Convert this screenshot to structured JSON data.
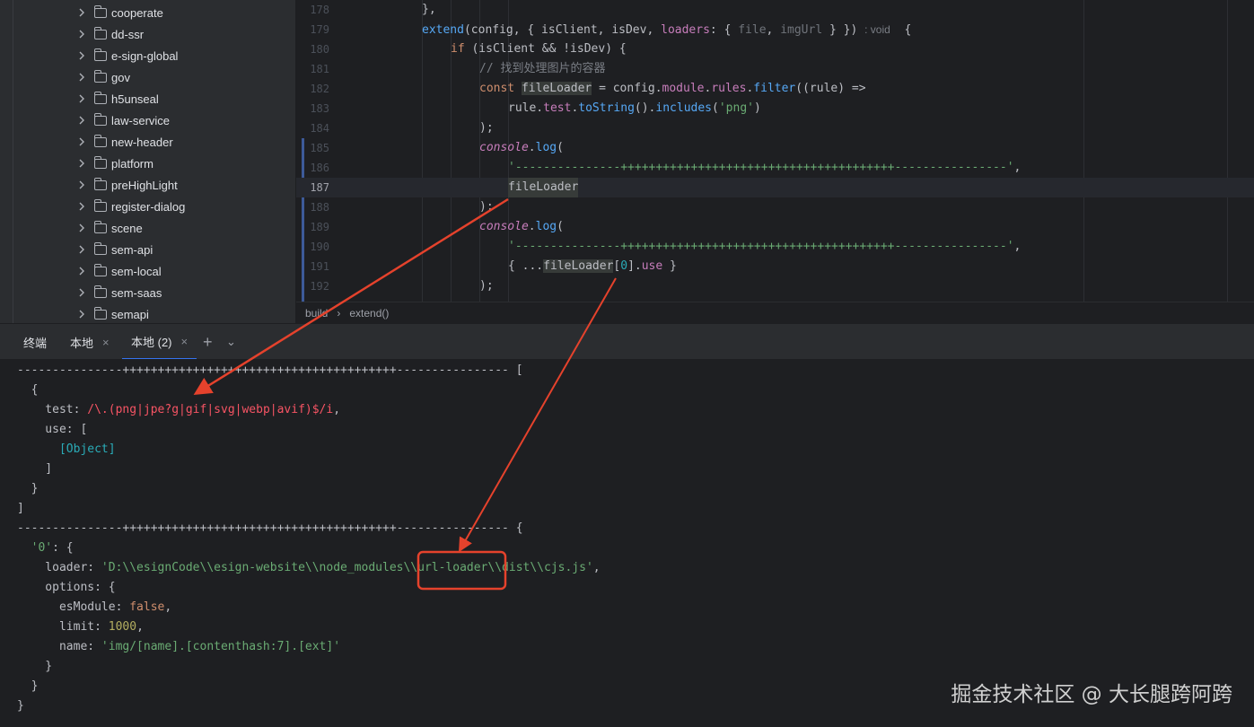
{
  "colors": {
    "background": "#1e1f22",
    "panel": "#2b2d30",
    "keyword": "#cf8e6d",
    "function": "#56a8f5",
    "string": "#6aab73",
    "property": "#c77dbb",
    "number": "#2aacb8",
    "red": "#f75464",
    "arrow": "#e5422c"
  },
  "project_tree": {
    "items": [
      "cooperate",
      "dd-ssr",
      "e-sign-global",
      "gov",
      "h5unseal",
      "law-service",
      "new-header",
      "platform",
      "preHighLight",
      "register-dialog",
      "scene",
      "sem-api",
      "sem-local",
      "sem-saas",
      "semapi"
    ]
  },
  "editor": {
    "line_numbers": [
      "178",
      "179",
      "180",
      "181",
      "182",
      "183",
      "184",
      "185",
      "186",
      "187",
      "188",
      "189",
      "190",
      "191",
      "192"
    ],
    "l178": "},",
    "l179": {
      "a": "extend",
      "b": "(config, { isClient, isDev, ",
      "c": "loaders",
      "d": ": { ",
      "e": "file",
      "f": ", ",
      "g": "imgUrl",
      "h": " } }) ",
      "hint": ": void",
      "i": "  {"
    },
    "l180": {
      "a": "if",
      "b": " (isClient && !isDev) {"
    },
    "l181": "// 找到处理图片的容器",
    "l182": {
      "a": "const ",
      "b": "fileLoader",
      "c": " = config.",
      "d": "module",
      "e": ".",
      "f": "rules",
      "g": ".",
      "h": "filter",
      "i": "((rule) =>"
    },
    "l183": {
      "a": "rule.",
      "b": "test",
      "c": ".",
      "d": "toString",
      "e": "().",
      "f": "includes",
      "g": "(",
      "h": "'png'",
      "i": ")"
    },
    "l184": ");",
    "l185": {
      "a": "console",
      "b": ".",
      "c": "log",
      "d": "("
    },
    "l186": {
      "a": "'---------------+++++++++++++++++++++++++++++++++++++++----------------'",
      "b": ","
    },
    "l187": "fileLoader",
    "l188": ");",
    "l189": {
      "a": "console",
      "b": ".",
      "c": "log",
      "d": "("
    },
    "l190": {
      "a": "'---------------+++++++++++++++++++++++++++++++++++++++----------------'",
      "b": ","
    },
    "l191": {
      "a": "{ ...",
      "b": "fileLoader",
      "c": "[",
      "d": "0",
      "e": "].",
      "f": "use",
      "g": " }"
    },
    "l192": ");"
  },
  "breadcrumb": {
    "item1": "build",
    "sep": "›",
    "item2": "extend()"
  },
  "tabs": {
    "terminal": "终端",
    "local": "本地",
    "local2": "本地 (2)",
    "close": "×",
    "add": "+",
    "more": "⌄"
  },
  "terminal_output": {
    "t1": "---------------+++++++++++++++++++++++++++++++++++++++---------------- [",
    "t2": "  {",
    "t3a": "    test: ",
    "t3b": "/\\.(png|jpe?g|gif|svg|webp|avif)$/i",
    "t3c": ",",
    "t4": "    use: [",
    "t5": "      [Object]",
    "t6": "    ]",
    "t7": "  }",
    "t8": "]",
    "t9": "---------------+++++++++++++++++++++++++++++++++++++++---------------- {",
    "t10a": "  ",
    "t10b": "'0'",
    "t10c": ": {",
    "t11a": "    loader: ",
    "t11b": "'D:\\\\esignCode\\\\esign-website\\\\node_modules\\\\url-loader\\\\dist\\\\cjs.js'",
    "t11c": ",",
    "t12": "    options: {",
    "t13a": "      esModule: ",
    "t13b": "false",
    "t13c": ",",
    "t14a": "      limit: ",
    "t14b": "1000",
    "t14c": ",",
    "t15a": "      name: ",
    "t15b": "'img/[name].[contenthash:7].[ext]'",
    "t16": "    }",
    "t17": "  }",
    "t18": "}"
  },
  "watermark": "掘金技术社区 @ 大长腿跨阿跨"
}
